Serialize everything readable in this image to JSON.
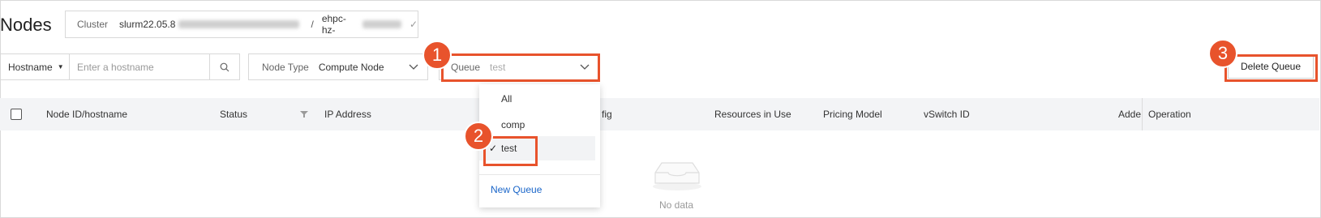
{
  "page": {
    "title": "Nodes"
  },
  "cluster": {
    "label": "Cluster",
    "name": "slurm22.05.8",
    "region": "ehpc-hz-"
  },
  "filters": {
    "hostname_type": "Hostname",
    "hostname_placeholder": "Enter a hostname",
    "node_type_label": "Node Type",
    "node_type_value": "Compute Node",
    "queue_label": "Queue",
    "queue_value": "test"
  },
  "actions": {
    "delete_queue": "Delete Queue"
  },
  "table": {
    "columns": [
      "Node ID/hostname",
      "Status",
      "IP Address",
      "fig",
      "Resources in Use",
      "Pricing Model",
      "vSwitch ID",
      "Adde",
      "Operation"
    ],
    "empty_text": "No data"
  },
  "queue_dropdown": {
    "options": [
      "All",
      "comp",
      "test"
    ],
    "selected": "test",
    "check": "✓",
    "new_queue": "New Queue"
  },
  "callouts": [
    "1",
    "2",
    "3"
  ],
  "colors": {
    "callout": "#e8532c",
    "link": "#1a66c9",
    "header_bg": "#f3f4f6"
  }
}
